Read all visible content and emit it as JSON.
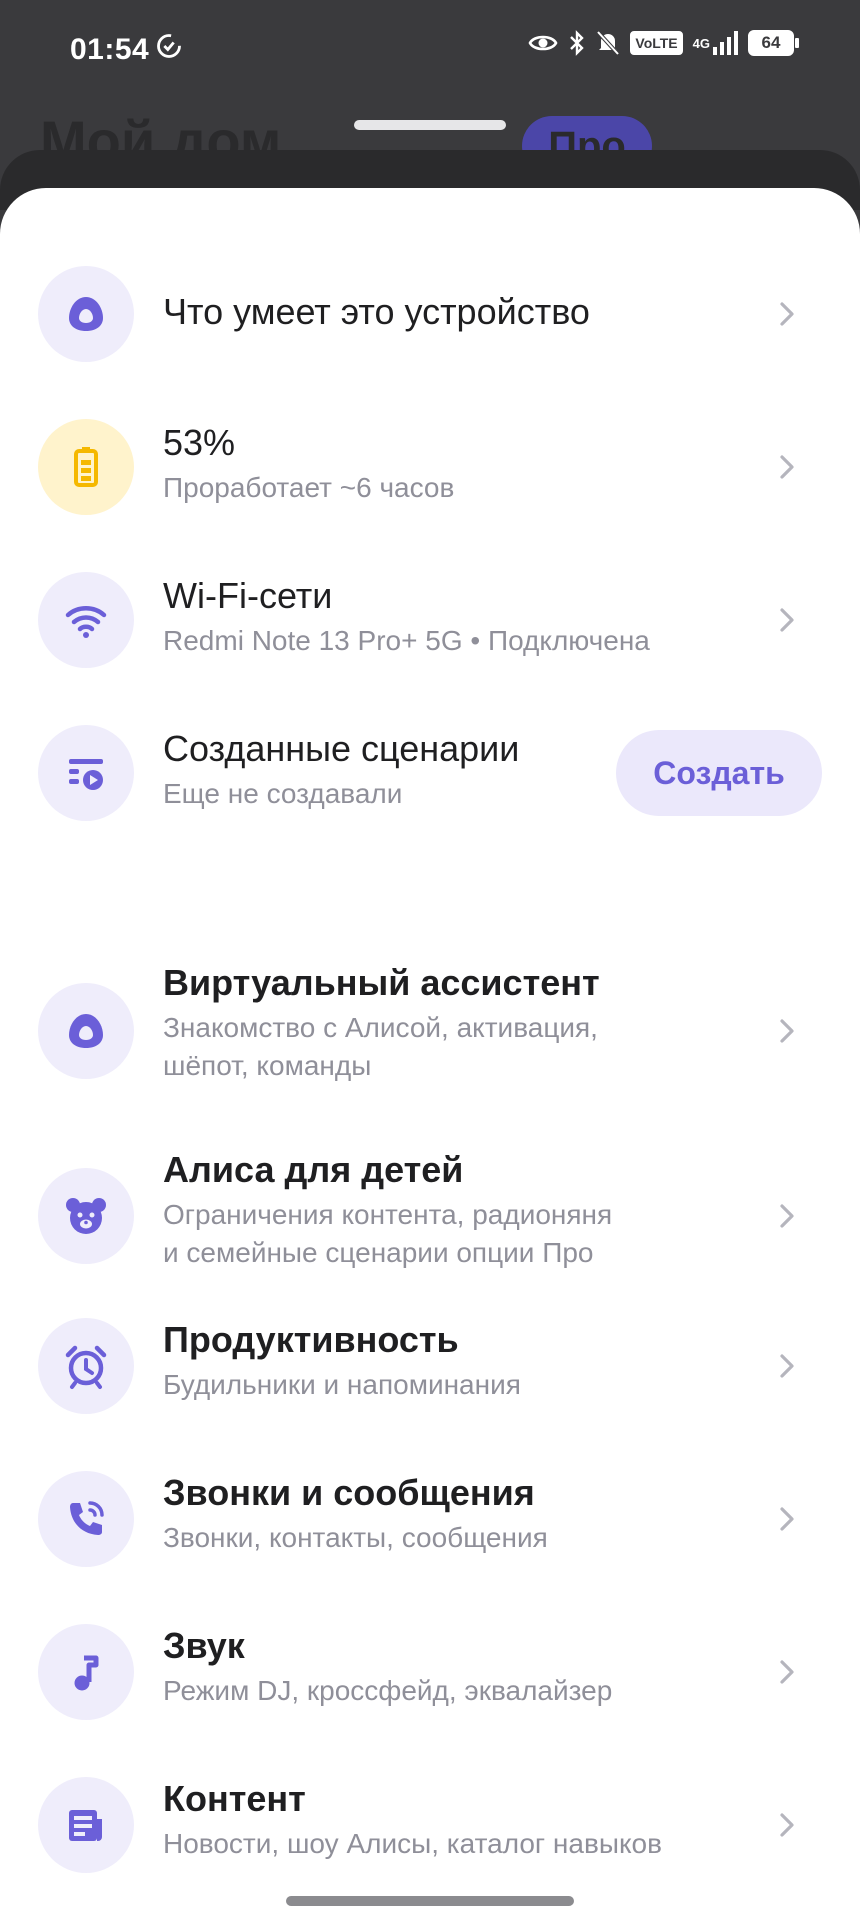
{
  "status_bar": {
    "time": "01:54",
    "volte": "VoLTE",
    "network": "4G",
    "battery": "64"
  },
  "background": {
    "title": "Мой дом",
    "pro_badge": "Про"
  },
  "top_items": [
    {
      "title": "Что умеет это устройство",
      "subtitle": ""
    },
    {
      "title": "53%",
      "subtitle": "Проработает ~6 часов"
    },
    {
      "title": "Wi-Fi-сети",
      "subtitle": "Redmi Note 13 Pro+ 5G • Подключена"
    },
    {
      "title": "Созданные сценарии",
      "subtitle": "Еще не создавали",
      "button": "Создать"
    }
  ],
  "settings_items": [
    {
      "title": "Виртуальный ассистент",
      "subtitle_1": "Знакомство с Алисой, активация,",
      "subtitle_2": "шёпот, команды"
    },
    {
      "title": "Алиса для детей",
      "subtitle_1": "Ограничения контента, радионяня",
      "subtitle_2": "и семейные сценарии опции Про"
    },
    {
      "title": "Продуктивность",
      "subtitle": "Будильники и напоминания"
    },
    {
      "title": "Звонки и сообщения",
      "subtitle": "Звонки, контакты, сообщения"
    },
    {
      "title": "Звук",
      "subtitle": "Режим DJ, кроссфейд, эквалайзер"
    },
    {
      "title": "Контент",
      "subtitle": "Новости, шоу Алисы, каталог навыков"
    }
  ],
  "colors": {
    "accent": "#6b5fd8",
    "icon_bg": "#efedfb",
    "battery_icon_bg": "#fff3cc",
    "battery_icon": "#f5b800"
  }
}
